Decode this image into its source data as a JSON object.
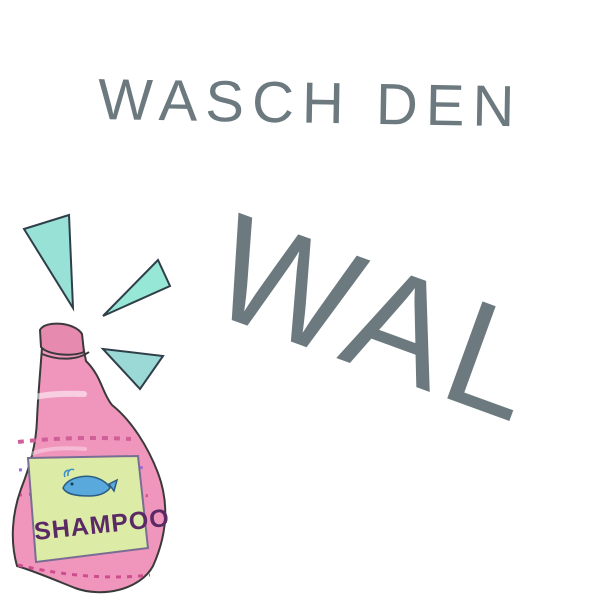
{
  "scene": {
    "headline": "WASCH DEN",
    "accent_word": "WAL",
    "bottle_label": "SHAMPOO",
    "colors": {
      "background": "#ffffff",
      "ink": "#6c7a80",
      "bottle": "#f28fb8",
      "bottle_outline": "#3a3a3a",
      "label_fill": "#dbeca4",
      "label_text": "#5b2a66",
      "whale": "#4fa0d5",
      "spark": "#8fd8d0"
    },
    "icons": [
      "shampoo-bottle-icon",
      "whale-icon",
      "spark-icon"
    ]
  }
}
